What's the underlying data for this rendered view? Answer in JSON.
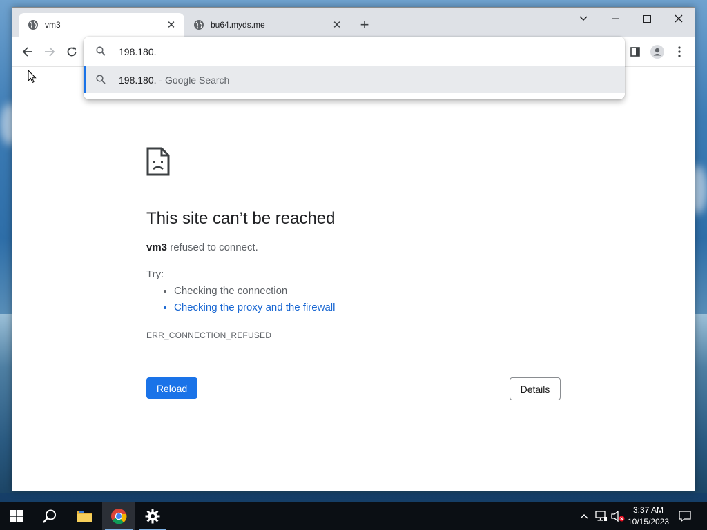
{
  "browser": {
    "tabs": [
      {
        "title": "vm3",
        "active": true
      },
      {
        "title": "bu64.myds.me",
        "active": false
      }
    ],
    "omnibox": {
      "input_value": "198.180.",
      "suggestion_query": "198.180.",
      "suggestion_suffix": " - Google Search"
    }
  },
  "error_page": {
    "title": "This site can’t be reached",
    "host": "vm3",
    "description": " refused to connect.",
    "try_label": "Try:",
    "suggestions": [
      "Checking the connection",
      "Checking the proxy and the firewall"
    ],
    "error_code": "ERR_CONNECTION_REFUSED",
    "reload_label": "Reload",
    "details_label": "Details"
  },
  "taskbar": {
    "time": "3:37 AM",
    "date": "10/15/2023"
  },
  "colors": {
    "accent_blue": "#1a73e8",
    "link_blue": "#1967d2",
    "tabstrip": "#dee1e6",
    "taskbar": "#0b0f14"
  }
}
